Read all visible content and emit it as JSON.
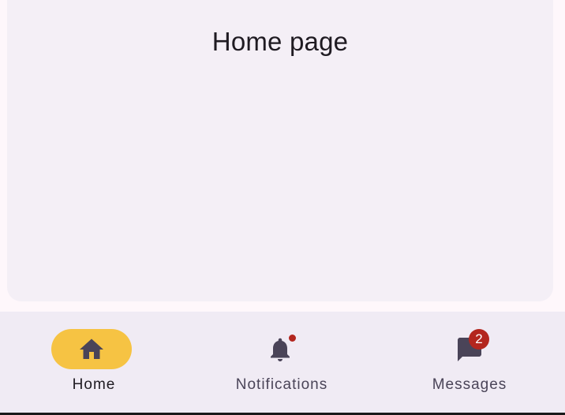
{
  "colors": {
    "background": "#fef7fb",
    "card": "#f4eff6",
    "nav_bar": "#f0ebf4",
    "active_indicator": "#f6c343",
    "icon": "#4a4458",
    "badge": "#b3261e"
  },
  "page": {
    "title": "Home page"
  },
  "nav": {
    "items": [
      {
        "label": "Home",
        "icon": "home-icon",
        "selected": true
      },
      {
        "label": "Notifications",
        "icon": "bell-icon",
        "badge": "dot"
      },
      {
        "label": "Messages",
        "icon": "chat-icon",
        "badge_count": "2"
      }
    ]
  }
}
